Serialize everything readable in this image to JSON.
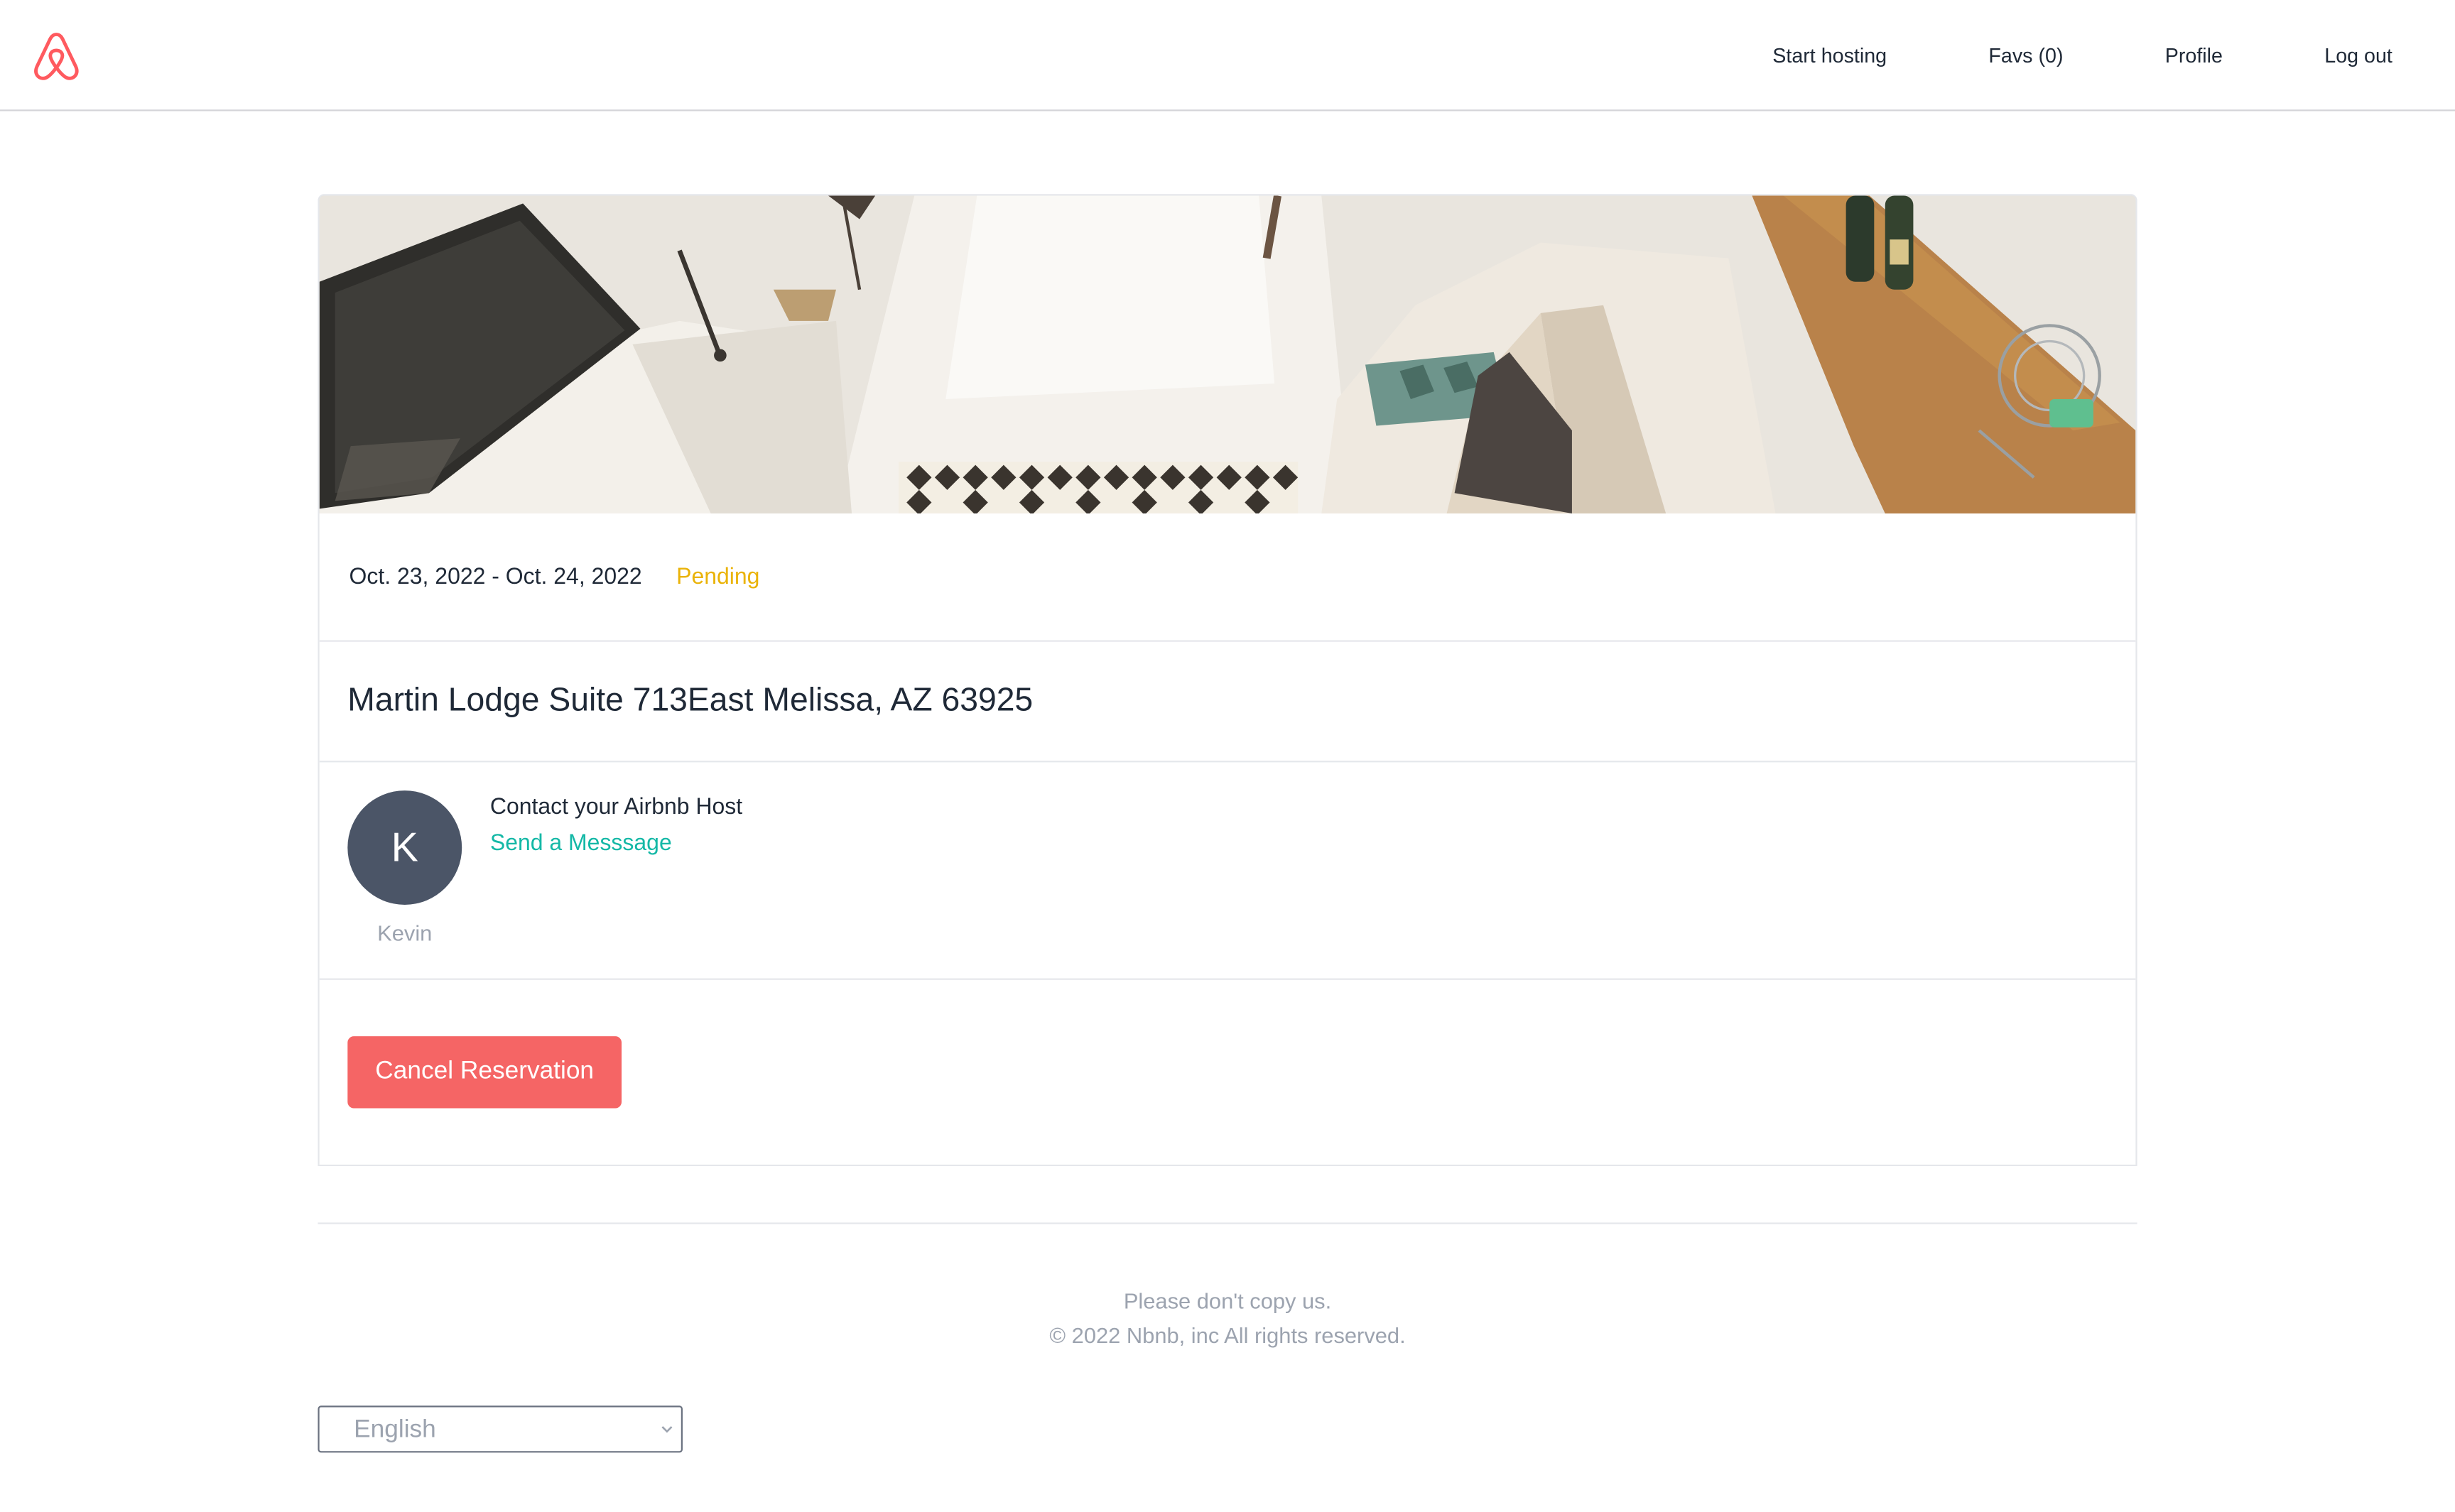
{
  "header": {
    "logo": "airbnb-logo",
    "nav": [
      {
        "label": "Start hosting"
      },
      {
        "label": "Favs (0)"
      },
      {
        "label": "Profile"
      },
      {
        "label": "Log out"
      }
    ]
  },
  "reservation": {
    "dates": "Oct. 23, 2022 - Oct. 24, 2022",
    "status": "Pending",
    "address": "Martin Lodge Suite 713East Melissa, AZ 63925",
    "host": {
      "initial": "K",
      "name": "Kevin",
      "contact_title": "Contact your Airbnb Host",
      "contact_link": "Send a Messsage"
    },
    "cancel_label": "Cancel Reservation"
  },
  "footer": {
    "line1": "Please don't copy us.",
    "line2": "© 2022 Nbnb, inc All rights reserved.",
    "language": "English"
  },
  "colors": {
    "brand": "#ff5a5f",
    "pending": "#eab308",
    "link": "#14b8a6",
    "cancel": "#f56565",
    "avatar": "#4b5567"
  }
}
